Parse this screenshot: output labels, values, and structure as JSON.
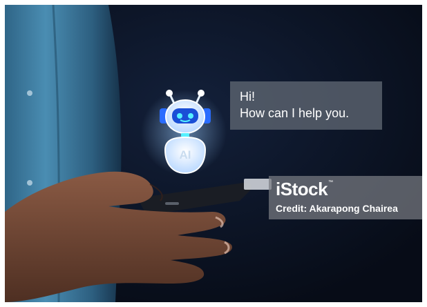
{
  "speech_bubble": {
    "line1": "Hi!",
    "line2": "How can I help you."
  },
  "robot": {
    "badge": "AI"
  },
  "watermark": {
    "logo": "iStock",
    "trademark": "™",
    "credit": "Credit: Akarapong Chairea"
  },
  "colors": {
    "background": "#0b1322",
    "shirt": "#3f7fa3",
    "robot_glow": "#cfe6ff",
    "robot_blue": "#2a6cff",
    "robot_eyes": "#55f0ff"
  }
}
